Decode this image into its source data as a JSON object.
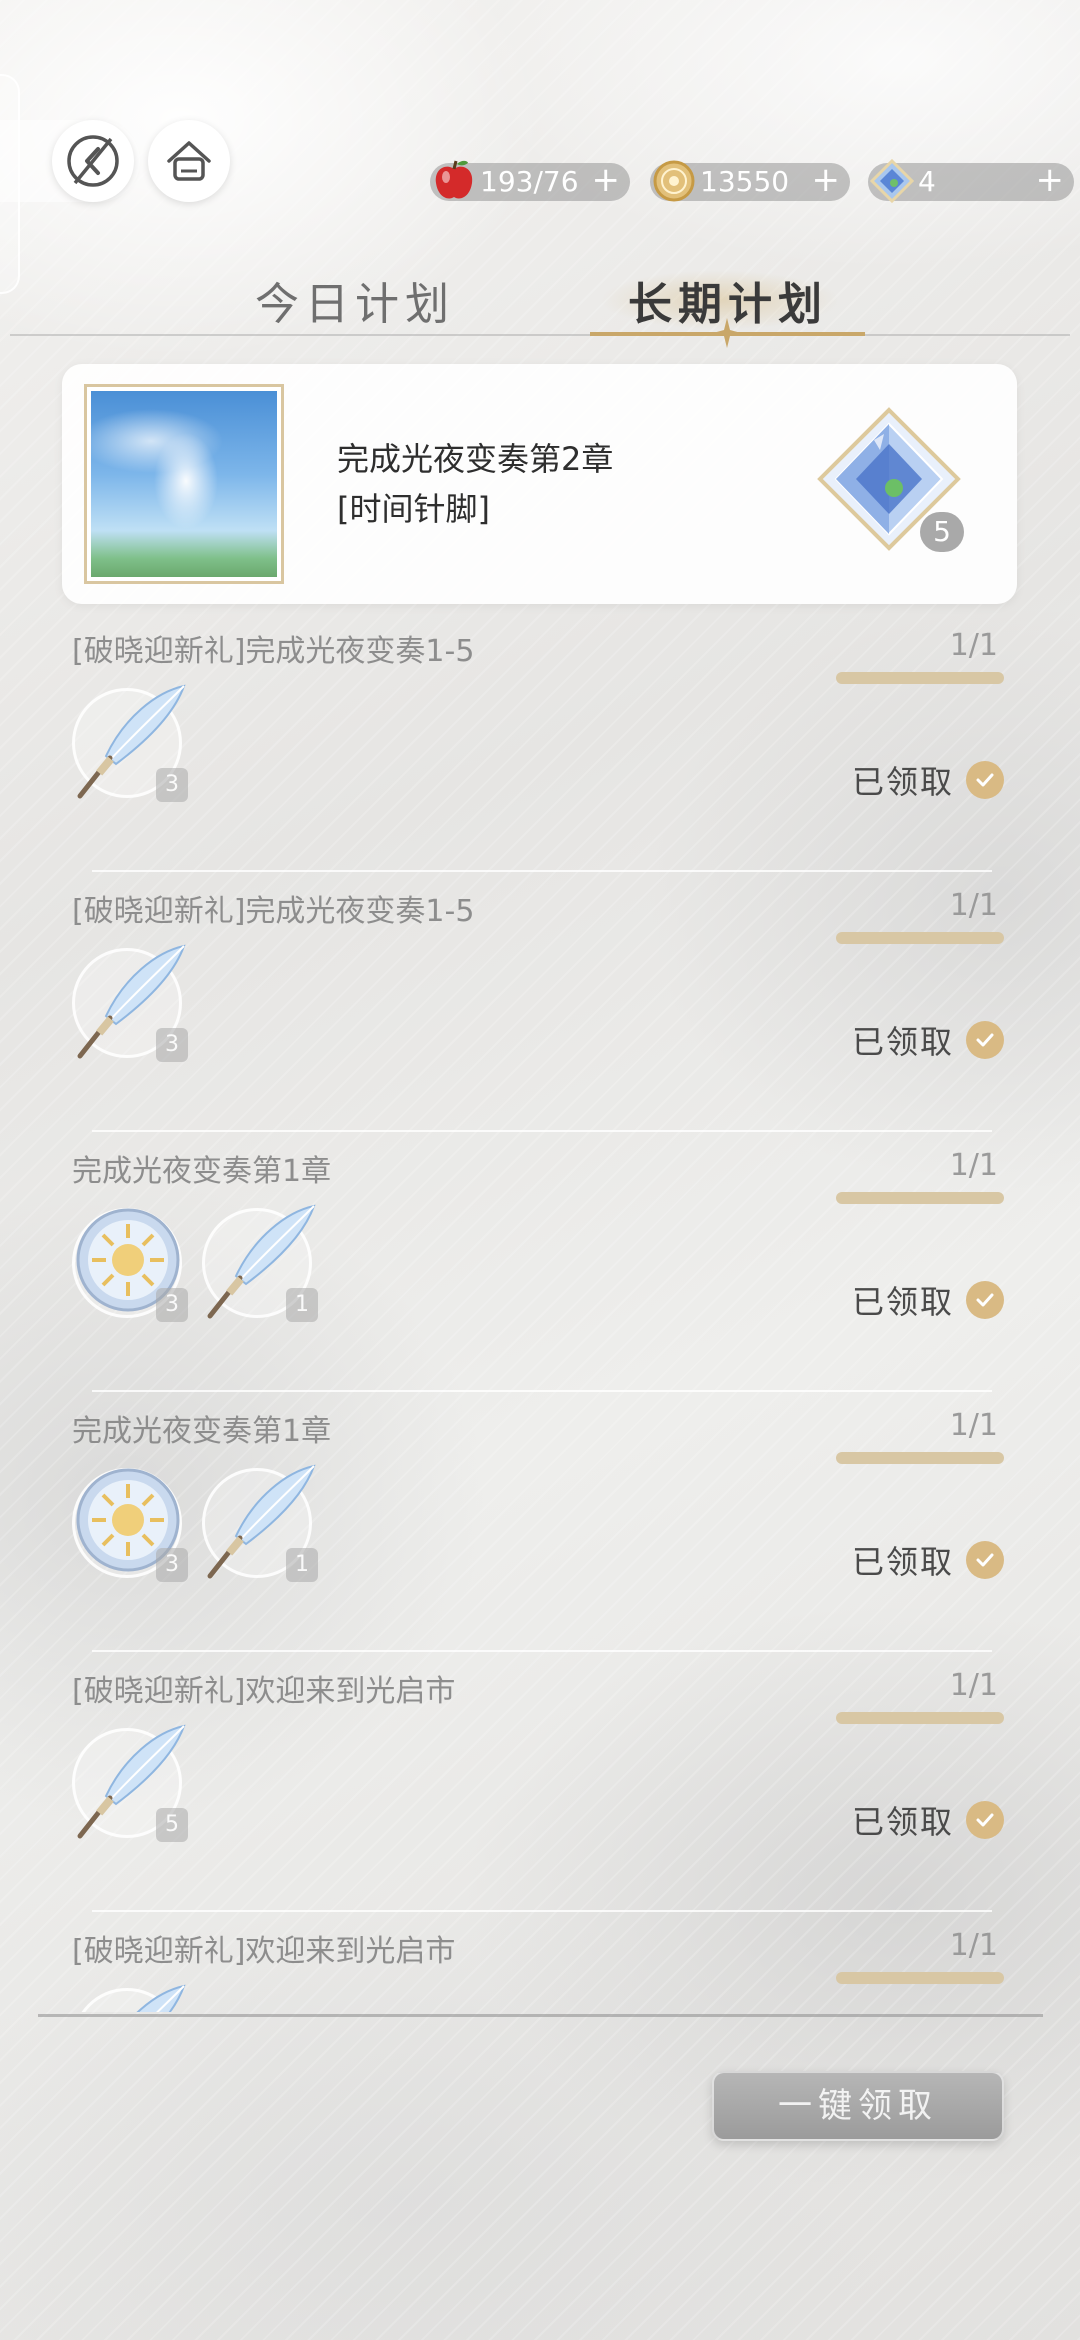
{
  "header": {
    "back_icon": "back-arrow-icon",
    "home_icon": "home-icon",
    "resources": [
      {
        "name": "stamina",
        "icon": "apple-icon",
        "value": "193/76",
        "plus": "+"
      },
      {
        "name": "coins",
        "icon": "coin-icon",
        "value": "13550",
        "plus": "+"
      },
      {
        "name": "crystals",
        "icon": "crystal-icon",
        "value": "4",
        "plus": "+"
      }
    ]
  },
  "tabs": {
    "today": "今日计划",
    "long_term": "长期计划",
    "active": "long_term"
  },
  "featured": {
    "title_line1": "完成光夜变奏第2章",
    "title_line2": "[时间针脚]",
    "reward_icon": "crystal-icon",
    "reward_count": "5"
  },
  "tasks": [
    {
      "title": "[破晓迎新礼]完成光夜变奏1-5",
      "progress": "1/1",
      "progress_fraction": 1.0,
      "status": "已领取",
      "rewards": [
        {
          "icon": "feather-quill-icon",
          "count": "3"
        }
      ]
    },
    {
      "title": "[破晓迎新礼]完成光夜变奏1-5",
      "progress": "1/1",
      "progress_fraction": 1.0,
      "status": "已领取",
      "rewards": [
        {
          "icon": "feather-quill-icon",
          "count": "3"
        }
      ]
    },
    {
      "title": "完成光夜变奏第1章",
      "progress": "1/1",
      "progress_fraction": 1.0,
      "status": "已领取",
      "rewards": [
        {
          "icon": "sun-medallion-icon",
          "count": "3"
        },
        {
          "icon": "feather-quill-icon",
          "count": "1"
        }
      ]
    },
    {
      "title": "完成光夜变奏第1章",
      "progress": "1/1",
      "progress_fraction": 1.0,
      "status": "已领取",
      "rewards": [
        {
          "icon": "sun-medallion-icon",
          "count": "3"
        },
        {
          "icon": "feather-quill-icon",
          "count": "1"
        }
      ]
    },
    {
      "title": "[破晓迎新礼]欢迎来到光启市",
      "progress": "1/1",
      "progress_fraction": 1.0,
      "status": "已领取",
      "rewards": [
        {
          "icon": "feather-quill-icon",
          "count": "5"
        }
      ]
    },
    {
      "title": "[破晓迎新礼]欢迎来到光启市",
      "progress": "1/1",
      "progress_fraction": 1.0,
      "status": "",
      "rewards": [
        {
          "icon": "feather-quill-icon",
          "count": ""
        }
      ]
    }
  ],
  "footer": {
    "claim_all_label": "一键领取"
  }
}
